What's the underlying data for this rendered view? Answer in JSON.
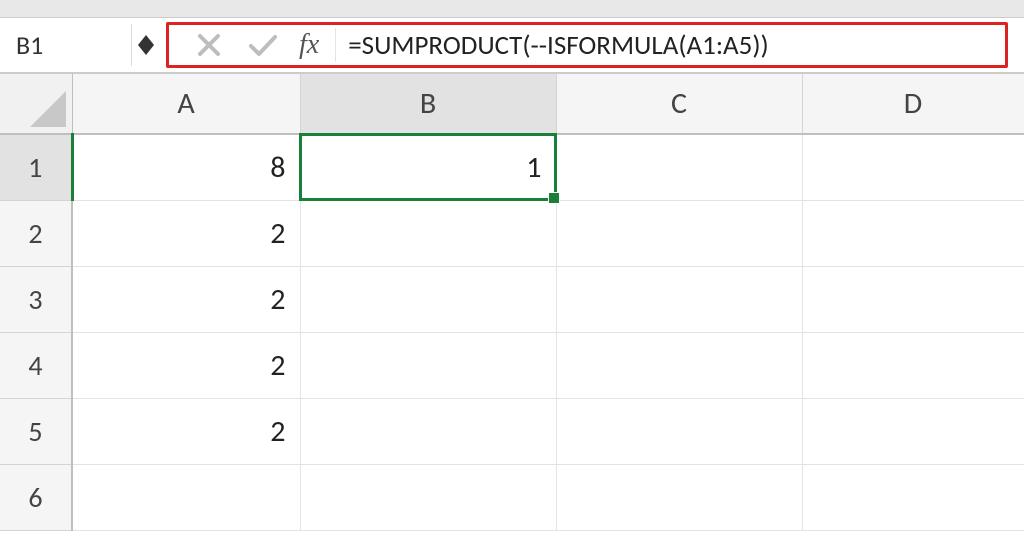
{
  "namebox": {
    "value": "B1"
  },
  "formula_bar": {
    "fx_label": "fx",
    "formula": "=SUMPRODUCT(--ISFORMULA(A1:A5))"
  },
  "columns": [
    "A",
    "B",
    "C",
    "D"
  ],
  "rows": [
    "1",
    "2",
    "3",
    "4",
    "5",
    "6"
  ],
  "active_column_index": 1,
  "active_row_index": 0,
  "cells": {
    "A1": "8",
    "A2": "2",
    "A3": "2",
    "A4": "2",
    "A5": "2",
    "B1": "1"
  },
  "selected_cell": "B1"
}
